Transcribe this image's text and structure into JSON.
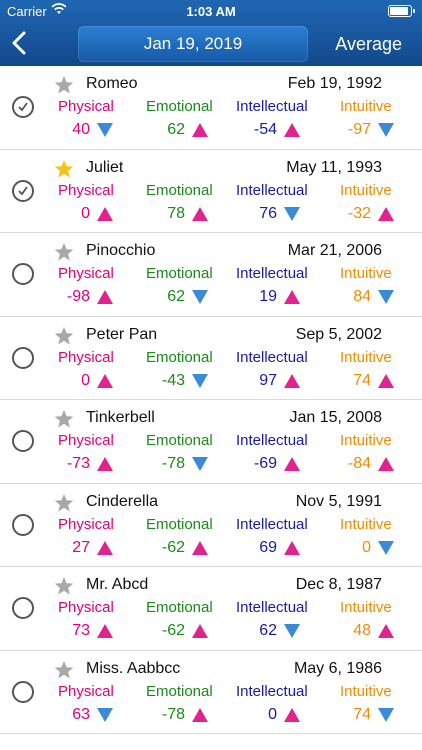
{
  "status_bar": {
    "carrier": "Carrier",
    "time": "1:03 AM",
    "battery_level": 0.9
  },
  "header": {
    "date": "Jan 19, 2019",
    "average_label": "Average"
  },
  "cycle_labels": {
    "physical": "Physical",
    "emotional": "Emotional",
    "intellectual": "Intellectual",
    "intuitive": "Intuitive"
  },
  "colors": {
    "physical": "#e0007a",
    "emotional": "#1a8a1a",
    "intellectual": "#1a1aa8",
    "intuitive": "#f08c00",
    "up_triangle": "#e0238e",
    "down_triangle": "#3a8ad6",
    "header": "#1a5ba6",
    "favorite_star": "#f7c21a",
    "plain_star": "#a8a8a8"
  },
  "people": [
    {
      "name": "Romeo",
      "birthdate": "Feb 19, 1992",
      "selected": true,
      "favorite": false,
      "physical": {
        "value": "40",
        "trend": "down"
      },
      "emotional": {
        "value": "62",
        "trend": "up"
      },
      "intellectual": {
        "value": "-54",
        "trend": "up"
      },
      "intuitive": {
        "value": "-97",
        "trend": "down"
      }
    },
    {
      "name": "Juliet",
      "birthdate": "May 11, 1993",
      "selected": true,
      "favorite": true,
      "physical": {
        "value": "0",
        "trend": "up"
      },
      "emotional": {
        "value": "78",
        "trend": "up"
      },
      "intellectual": {
        "value": "76",
        "trend": "down"
      },
      "intuitive": {
        "value": "-32",
        "trend": "up"
      }
    },
    {
      "name": "Pinocchio",
      "birthdate": "Mar 21, 2006",
      "selected": false,
      "favorite": false,
      "physical": {
        "value": "-98",
        "trend": "up"
      },
      "emotional": {
        "value": "62",
        "trend": "down"
      },
      "intellectual": {
        "value": "19",
        "trend": "up"
      },
      "intuitive": {
        "value": "84",
        "trend": "down"
      }
    },
    {
      "name": "Peter Pan",
      "birthdate": "Sep 5, 2002",
      "selected": false,
      "favorite": false,
      "physical": {
        "value": "0",
        "trend": "up"
      },
      "emotional": {
        "value": "-43",
        "trend": "down"
      },
      "intellectual": {
        "value": "97",
        "trend": "up"
      },
      "intuitive": {
        "value": "74",
        "trend": "up"
      }
    },
    {
      "name": "Tinkerbell",
      "birthdate": "Jan 15, 2008",
      "selected": false,
      "favorite": false,
      "physical": {
        "value": "-73",
        "trend": "up"
      },
      "emotional": {
        "value": "-78",
        "trend": "down"
      },
      "intellectual": {
        "value": "-69",
        "trend": "up"
      },
      "intuitive": {
        "value": "-84",
        "trend": "up"
      }
    },
    {
      "name": "Cinderella",
      "birthdate": "Nov 5, 1991",
      "selected": false,
      "favorite": false,
      "physical": {
        "value": "27",
        "trend": "up"
      },
      "emotional": {
        "value": "-62",
        "trend": "up"
      },
      "intellectual": {
        "value": "69",
        "trend": "up"
      },
      "intuitive": {
        "value": "0",
        "trend": "down"
      }
    },
    {
      "name": "Mr. Abcd",
      "birthdate": "Dec 8, 1987",
      "selected": false,
      "favorite": false,
      "physical": {
        "value": "73",
        "trend": "up"
      },
      "emotional": {
        "value": "-62",
        "trend": "up"
      },
      "intellectual": {
        "value": "62",
        "trend": "down"
      },
      "intuitive": {
        "value": "48",
        "trend": "up"
      }
    },
    {
      "name": "Miss. Aabbcc",
      "birthdate": "May 6, 1986",
      "selected": false,
      "favorite": false,
      "physical": {
        "value": "63",
        "trend": "down"
      },
      "emotional": {
        "value": "-78",
        "trend": "up"
      },
      "intellectual": {
        "value": "0",
        "trend": "up"
      },
      "intuitive": {
        "value": "74",
        "trend": "down"
      }
    }
  ]
}
